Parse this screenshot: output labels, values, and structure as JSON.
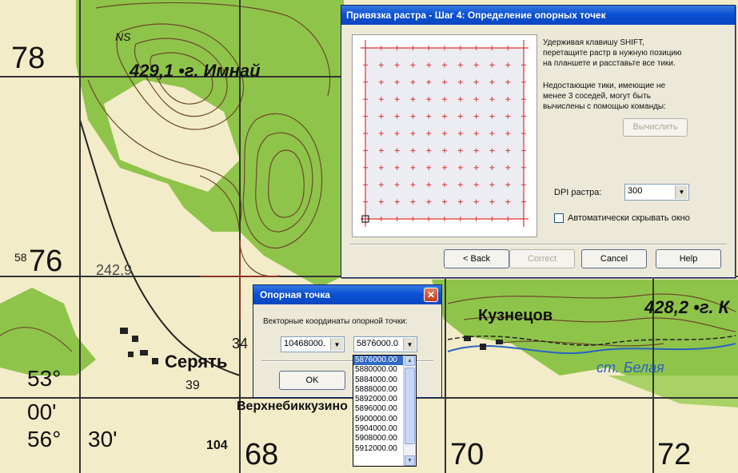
{
  "map": {
    "grid_labels": [
      "78",
      "76",
      "70",
      "72",
      "68"
    ],
    "grid_prefix": "58",
    "place_names": [
      "429,1 •г. Имнай",
      "Серять",
      "Верхнебиккузино",
      "Кузнецов",
      "428,2 •г. К",
      "ст. Белая"
    ],
    "heights": [
      "242,9",
      "39",
      "104",
      "34",
      "NS"
    ],
    "lat_lon": [
      "53°",
      "00'",
      "56°",
      "30'"
    ]
  },
  "main_dialog": {
    "title": "Привязка растра - Шаг 4: Определение опорных точек",
    "instruction_1": [
      "Удерживая клавишу SHIFT,",
      "перетащите растр в нужную позицию",
      "на планшете и расставьте все тики."
    ],
    "instruction_2": [
      "Недостающие тики, имеющие не",
      "менее 3 соседей, могут быть",
      "вычислены с помощью команды:"
    ],
    "compute_label": "Вычислить",
    "dpi_label": "DPI растра:",
    "dpi_value": "300",
    "autohide_label": "Автоматически скрывать окно",
    "back_label": "< Back",
    "correct_label": "Correct",
    "cancel_label": "Cancel",
    "help_label": "Help"
  },
  "point_dialog": {
    "title": "Опорная точка",
    "coords_label": "Векторные координаты опорной точки:",
    "x_value": "10468000.",
    "y_value": "5876000.0",
    "ok_label": "OK"
  },
  "dropdown": {
    "items": [
      "5876000.00",
      "5880000.00",
      "5884000.00",
      "5888000.00",
      "5892000.00",
      "5896000.00",
      "5900000.00",
      "5904000.00",
      "5908000.00",
      "5912000.00"
    ]
  },
  "colors": {
    "map_paper": "#f3ecc8",
    "forest": "#8fc44a",
    "contour": "#6b4a2a",
    "tick_red": "#e03030",
    "title_blue": "#0b51d4",
    "dialog_face": "#ece9d8"
  }
}
